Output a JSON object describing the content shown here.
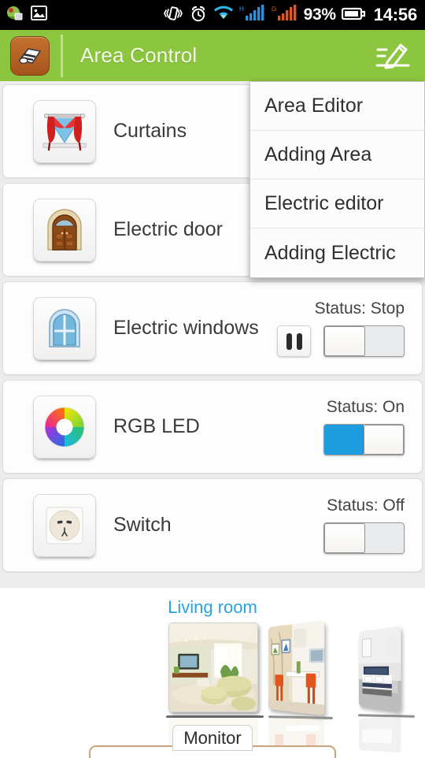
{
  "statusbar": {
    "battery_percent": "93%",
    "clock": "14:56",
    "icons": [
      "photo-app-icon",
      "gallery-icon",
      "vibrate-icon",
      "alarm-icon",
      "wifi-icon",
      "signal-h-icon",
      "signal-g-icon",
      "battery-icon"
    ],
    "signal_h_label": "H",
    "signal_g_label": "G"
  },
  "header": {
    "title": "Area Control",
    "app_icon": "book-app-icon",
    "edit_icon": "edit-pencil-icon",
    "background_color": "#8cc63e"
  },
  "menu": {
    "items": [
      {
        "label": "Area Editor"
      },
      {
        "label": "Adding Area"
      },
      {
        "label": "Electric editor"
      },
      {
        "label": "Adding Electric"
      }
    ]
  },
  "devices": [
    {
      "name": "Curtains",
      "icon": "curtains-icon",
      "has_status": false,
      "status": "",
      "has_pause": false,
      "toggle_state": "none"
    },
    {
      "name": "Electric door",
      "icon": "door-icon",
      "has_status": false,
      "status": "",
      "has_pause": false,
      "toggle_state": "none"
    },
    {
      "name": "Electric windows",
      "icon": "window-icon",
      "has_status": true,
      "status": "Status: Stop",
      "has_pause": true,
      "toggle_state": "off"
    },
    {
      "name": "RGB LED",
      "icon": "color-wheel-icon",
      "has_status": true,
      "status": "Status: On",
      "has_pause": false,
      "toggle_state": "on"
    },
    {
      "name": "Switch",
      "icon": "power-socket-icon",
      "has_status": true,
      "status": "Status: Off",
      "has_pause": false,
      "toggle_state": "off"
    }
  ],
  "gallery": {
    "selected_room": "Living room",
    "thumbnails": [
      {
        "name": "living-room-thumbnail"
      },
      {
        "name": "dining-room-thumbnail"
      },
      {
        "name": "bedroom-thumbnail"
      }
    ]
  },
  "bottom": {
    "tab_label": "Monitor"
  },
  "colors": {
    "header_green": "#8cc63e",
    "toggle_on_blue": "#1e9ce0",
    "room_label_blue": "#29a3dd"
  }
}
